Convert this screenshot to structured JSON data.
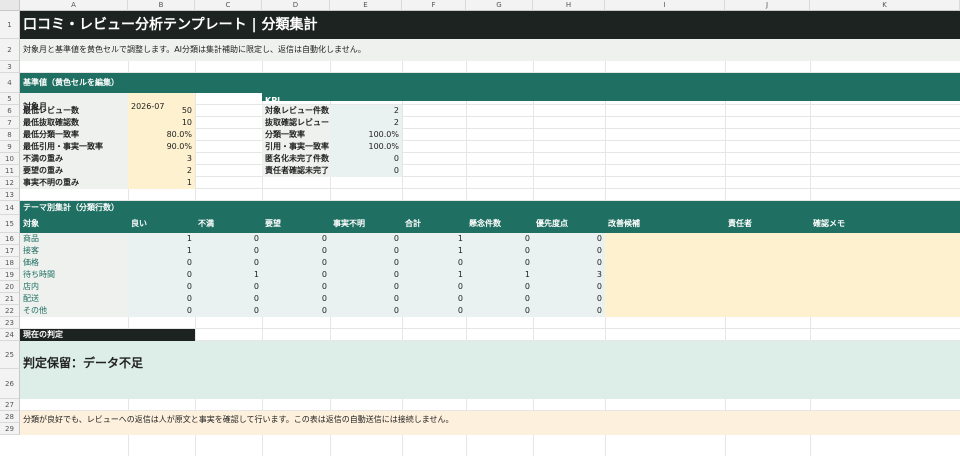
{
  "columns": [
    "A",
    "B",
    "C",
    "D",
    "E",
    "F",
    "G",
    "H",
    "I",
    "J",
    "K"
  ],
  "title": "口コミ・レビュー分析テンプレート | 分類集計",
  "note": "対象月と基準値を黄色セルで調整します。AI分類は集計補助に限定し、返信は自動化しません。",
  "settings": {
    "header": "基準値（黄色セルを編集）",
    "items": [
      {
        "label": "対象月",
        "value": "2026-07"
      },
      {
        "label": "最低レビュー数",
        "value": "50"
      },
      {
        "label": "最低抜取確認数",
        "value": "10"
      },
      {
        "label": "最低分類一致率",
        "value": "80.0%"
      },
      {
        "label": "最低引用・事実一致率",
        "value": "90.0%"
      },
      {
        "label": "不満の重み",
        "value": "3"
      },
      {
        "label": "要望の重み",
        "value": "2"
      },
      {
        "label": "事実不明の重み",
        "value": "1"
      }
    ]
  },
  "kpi": {
    "header": "KPI",
    "items": [
      {
        "label": "対象レビュー件数",
        "value": "2"
      },
      {
        "label": "抜取確認レビュー",
        "value": "2"
      },
      {
        "label": "分類一致率",
        "value": "100.0%"
      },
      {
        "label": "引用・事実一致率",
        "value": "100.0%"
      },
      {
        "label": "匿名化未完了件数",
        "value": "0"
      },
      {
        "label": "責任者確認未完了",
        "value": "0"
      }
    ]
  },
  "theme": {
    "header": "テーマ別集計（分類行数）",
    "columns": [
      "対象",
      "良い",
      "不満",
      "要望",
      "事実不明",
      "合計",
      "懸念件数",
      "優先度点",
      "改善候補",
      "責任者",
      "確認メモ"
    ],
    "rows": [
      {
        "name": "商品",
        "values": [
          "1",
          "0",
          "0",
          "0",
          "1",
          "0",
          "0"
        ]
      },
      {
        "name": "接客",
        "values": [
          "1",
          "0",
          "0",
          "0",
          "1",
          "0",
          "0"
        ]
      },
      {
        "name": "価格",
        "values": [
          "0",
          "0",
          "0",
          "0",
          "0",
          "0",
          "0"
        ]
      },
      {
        "name": "待ち時間",
        "values": [
          "0",
          "1",
          "0",
          "0",
          "1",
          "1",
          "3"
        ]
      },
      {
        "name": "店内",
        "values": [
          "0",
          "0",
          "0",
          "0",
          "0",
          "0",
          "0"
        ]
      },
      {
        "name": "配送",
        "values": [
          "0",
          "0",
          "0",
          "0",
          "0",
          "0",
          "0"
        ]
      },
      {
        "name": "その他",
        "values": [
          "0",
          "0",
          "0",
          "0",
          "0",
          "0",
          "0"
        ]
      }
    ]
  },
  "judgment": {
    "header": "現在の判定",
    "value": "判定保留：データ不足"
  },
  "footer": "分類が良好でも、レビューへの返信は人が原文と事実を確認して行います。この表は返信の自動送信には接続しません。",
  "colors": {
    "dark_header": "#1c2321",
    "teal": "#1f6f62",
    "light_gray": "#eef1ee",
    "mint": "#ddeee8",
    "yellow": "#fdf1cf",
    "peach": "#fdf0dc",
    "kpi_value_bg": "#eaf1f1"
  }
}
